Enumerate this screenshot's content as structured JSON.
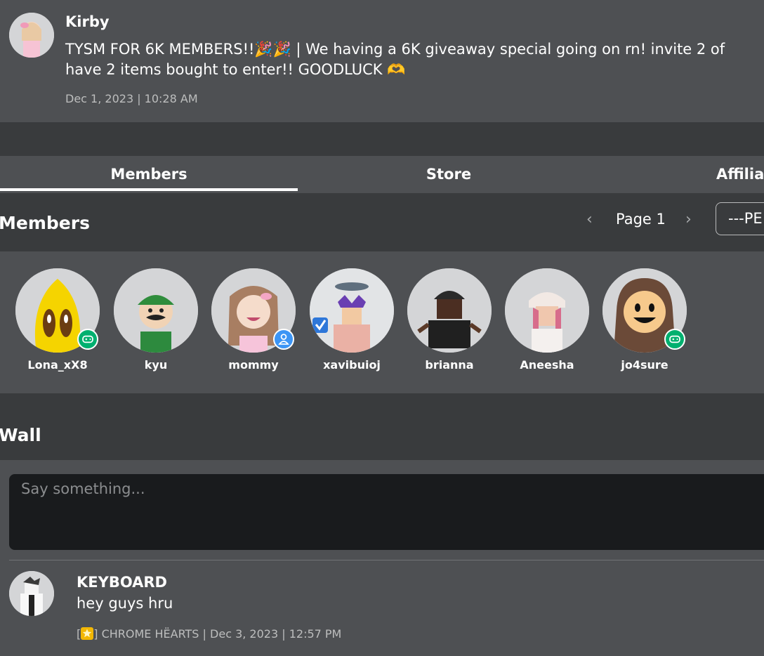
{
  "shout": {
    "author": "Kirby",
    "message": "TYSM FOR 6K MEMBERS!!🎉🎉 | We having a 6K giveaway special going on rn! invite 2 of\nhave 2 items bought to enter!! GOODLUCK 🫶",
    "date": "Dec 1, 2023 | 10:28 AM"
  },
  "tabs": [
    {
      "label": "Members"
    },
    {
      "label": "Store"
    },
    {
      "label": "Affilia"
    }
  ],
  "members_section": {
    "title": "Members",
    "page_label": "Page 1",
    "role_select": "---PE",
    "members": [
      {
        "name": "Lona_xX8",
        "badge": "gamepad-icon"
      },
      {
        "name": "kyu",
        "badge": ""
      },
      {
        "name": "mommy",
        "badge": "person-icon"
      },
      {
        "name": "xavibuioj",
        "badge": ""
      },
      {
        "name": "brianna",
        "badge": ""
      },
      {
        "name": "Aneesha",
        "badge": ""
      },
      {
        "name": "jo4sure",
        "badge": "gamepad-icon"
      }
    ]
  },
  "wall": {
    "title": "Wall",
    "input_placeholder": "Say something...",
    "posts": [
      {
        "author": "KEYBOARD",
        "body": "hey guys hru",
        "role_prefix": "[",
        "role_suffix": "] CHROME HËARTS | Dec 3, 2023 | 12:57 PM"
      }
    ]
  },
  "colors": {
    "page_bg": "#393b3d",
    "panel_bg": "#4e5053",
    "input_bg": "#191b1d",
    "badge_green": "#00b06f",
    "badge_blue": "#3c95f5"
  }
}
